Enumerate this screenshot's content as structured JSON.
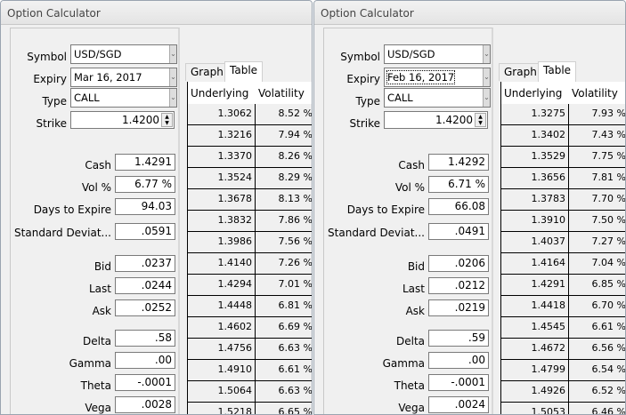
{
  "windows": [
    {
      "title": "Option Calculator",
      "labels": {
        "symbol": "Symbol",
        "expiry": "Expiry",
        "type": "Type",
        "strike": "Strike",
        "cash": "Cash",
        "vol": "Vol %",
        "days": "Days to Expire",
        "std": "Standard Deviat...",
        "bid": "Bid",
        "last": "Last",
        "ask": "Ask",
        "delta": "Delta",
        "gamma": "Gamma",
        "theta": "Theta",
        "vega": "Vega"
      },
      "symbol": "USD/SGD",
      "expiry": "Mar 16, 2017",
      "type": "CALL",
      "strike": "1.4200",
      "cash": "1.4291",
      "vol": "6.77 %",
      "days": "94.03",
      "std": ".0591",
      "bid": ".0237",
      "last": ".0244",
      "ask": ".0252",
      "delta": ".58",
      "gamma": ".00",
      "theta": "-.0001",
      "vega": ".0028",
      "tabs": [
        "Graph",
        "Table"
      ],
      "columns": [
        "Underlying",
        "Volatility"
      ],
      "rows": [
        [
          "1.3062",
          "8.52 %"
        ],
        [
          "1.3216",
          "7.94 %"
        ],
        [
          "1.3370",
          "8.26 %"
        ],
        [
          "1.3524",
          "8.29 %"
        ],
        [
          "1.3678",
          "8.13 %"
        ],
        [
          "1.3832",
          "7.86 %"
        ],
        [
          "1.3986",
          "7.56 %"
        ],
        [
          "1.4140",
          "7.26 %"
        ],
        [
          "1.4294",
          "7.01 %"
        ],
        [
          "1.4448",
          "6.81 %"
        ],
        [
          "1.4602",
          "6.69 %"
        ],
        [
          "1.4756",
          "6.63 %"
        ],
        [
          "1.4910",
          "6.61 %"
        ],
        [
          "1.5064",
          "6.63 %"
        ],
        [
          "1.5218",
          "6.65 %"
        ]
      ]
    },
    {
      "title": "Option Calculator",
      "labels": {
        "symbol": "Symbol",
        "expiry": "Expiry",
        "type": "Type",
        "strike": "Strike",
        "cash": "Cash",
        "vol": "Vol %",
        "days": "Days to Expire",
        "std": "Standard Deviat...",
        "bid": "Bid",
        "last": "Last",
        "ask": "Ask",
        "delta": "Delta",
        "gamma": "Gamma",
        "theta": "Theta",
        "vega": "Vega"
      },
      "symbol": "USD/SGD",
      "expiry": "Feb 16, 2017",
      "type": "CALL",
      "strike": "1.4200",
      "cash": "1.4292",
      "vol": "6.71 %",
      "days": "66.08",
      "std": ".0491",
      "bid": ".0206",
      "last": ".0212",
      "ask": ".0219",
      "delta": ".59",
      "gamma": ".00",
      "theta": "-.0001",
      "vega": ".0024",
      "tabs": [
        "Graph",
        "Table"
      ],
      "columns": [
        "Underlying",
        "Volatility"
      ],
      "rows": [
        [
          "1.3275",
          "7.93 %"
        ],
        [
          "1.3402",
          "7.43 %"
        ],
        [
          "1.3529",
          "7.75 %"
        ],
        [
          "1.3656",
          "7.81 %"
        ],
        [
          "1.3783",
          "7.70 %"
        ],
        [
          "1.3910",
          "7.50 %"
        ],
        [
          "1.4037",
          "7.27 %"
        ],
        [
          "1.4164",
          "7.04 %"
        ],
        [
          "1.4291",
          "6.85 %"
        ],
        [
          "1.4418",
          "6.70 %"
        ],
        [
          "1.4545",
          "6.61 %"
        ],
        [
          "1.4672",
          "6.56 %"
        ],
        [
          "1.4799",
          "6.54 %"
        ],
        [
          "1.4926",
          "6.52 %"
        ],
        [
          "1.5053",
          "6.46 %"
        ]
      ]
    }
  ]
}
